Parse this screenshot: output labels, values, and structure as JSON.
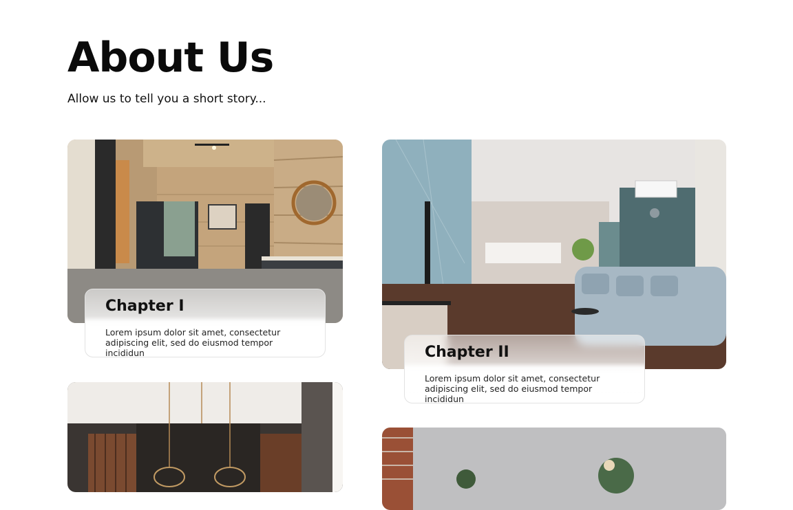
{
  "header": {
    "title": "About Us",
    "subtitle": "Allow us to tell you a short story..."
  },
  "chapters": [
    {
      "title": "Chapter I",
      "text": "Lorem ipsum dolor sit amet, consectetur adipiscing elit, sed do eiusmod tempor incididun"
    },
    {
      "title": "Chapter II",
      "text": "Lorem ipsum dolor sit amet, consectetur adipiscing elit, sed do eiusmod tempor incididun"
    }
  ]
}
